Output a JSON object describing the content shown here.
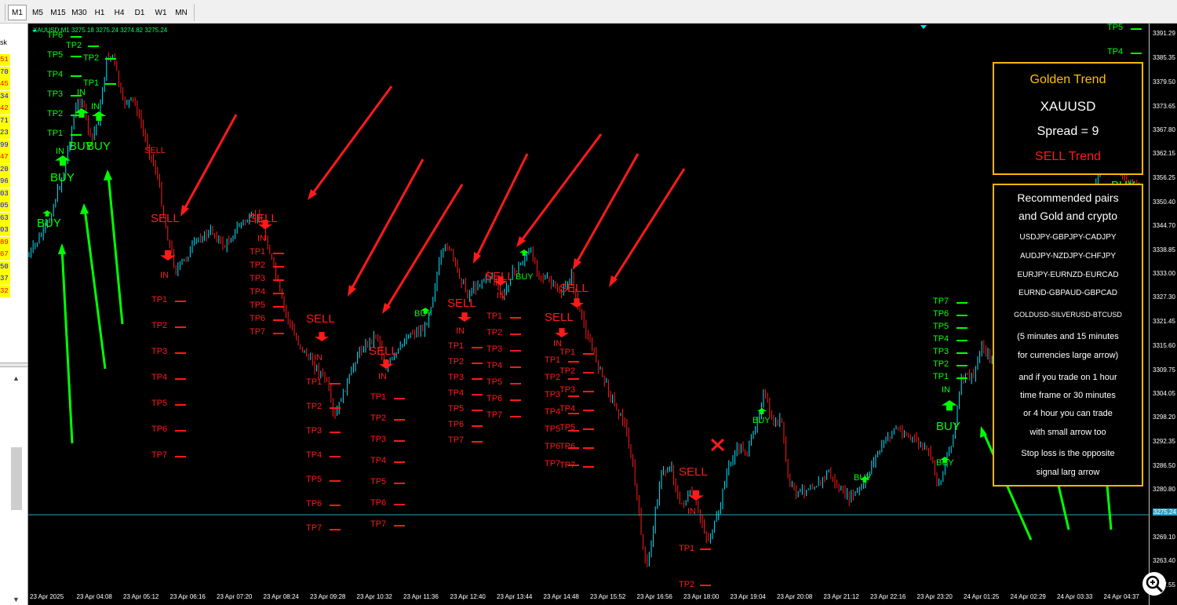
{
  "toolbar": {
    "timeframes": [
      "M1",
      "M5",
      "M15",
      "M30",
      "H1",
      "H4",
      "D1",
      "W1",
      "MN"
    ],
    "active": "M1"
  },
  "left_panel": {
    "label": "sk",
    "values": [
      "51",
      "70",
      "45",
      "34",
      "42",
      "71",
      "23",
      "99",
      "47",
      "20",
      "96",
      "03",
      "05",
      "63",
      "03",
      "89",
      "67",
      "50",
      "37",
      "32"
    ],
    "value_colors": [
      "#ff0000",
      "#0000ff",
      "#ff0000",
      "#0000ff",
      "#ff0000",
      "#0000ff",
      "#0000ff",
      "#0000ff",
      "#ff0000",
      "#0000ff",
      "#0000ff",
      "#0000ff",
      "#0000ff",
      "#0000ff",
      "#0000ff",
      "#ff0000",
      "#ff0000",
      "#0000ff",
      "#0000ff",
      "#ff0000"
    ]
  },
  "chart_header": "XAUUSD,M1 3275.18 3275.24 3274.82 3275.24",
  "price_axis": {
    "ticks": [
      "3391.29",
      "3385.35",
      "3379.50",
      "3373.65",
      "3367.80",
      "3362.15",
      "3356.25",
      "3350.40",
      "3344.70",
      "3338.85",
      "3333.00",
      "3327.30",
      "3321.45",
      "3315.60",
      "3309.75",
      "3304.05",
      "3298.20",
      "3292.35",
      "3286.50",
      "3280.80",
      "3275.24",
      "3269.10",
      "3263.40",
      "3257.55"
    ],
    "current_price": "3275.24",
    "scale": {
      "low": 3257.55,
      "high": 3391.29
    }
  },
  "time_axis": {
    "ticks": [
      "23 Apr 2025",
      "23 Apr 04:08",
      "23 Apr 05:12",
      "23 Apr 06:16",
      "23 Apr 07:20",
      "23 Apr 08:24",
      "23 Apr 09:28",
      "23 Apr 10:32",
      "23 Apr 11:36",
      "23 Apr 12:40",
      "23 Apr 13:44",
      "23 Apr 14:48",
      "23 Apr 15:52",
      "23 Apr 16:56",
      "23 Apr 18:00",
      "23 Apr 19:04",
      "23 Apr 20:08",
      "23 Apr 21:12",
      "23 Apr 22:16",
      "23 Apr 23:20",
      "24 Apr 01:25",
      "24 Apr 02:29",
      "24 Apr 03:33",
      "24 Apr 04:37"
    ]
  },
  "trend_box": {
    "title": "Golden Trend",
    "symbol": "XAUUSD",
    "spread": "Spread = 9",
    "trend": "SELL Trend"
  },
  "info_box": {
    "heading1": "Recommended pairs",
    "heading2": "and Gold and crypto",
    "pairs1": "USDJPY-GBPJPY-CADJPY",
    "pairs2": "AUDJPY-NZDJPY-CHFJPY",
    "pairs3": "EURJPY-EURNZD-EURCAD",
    "pairs4": "EURND-GBPAUD-GBPCAD",
    "pairs5": "GOLDUSD-SILVERUSD-BTCUSD",
    "note1": "(5 minutes and 15 minutes",
    "note2": "for currencies large arrow)",
    "note3": "and if you trade on 1 hour",
    "note4": "time frame or 30 minutes",
    "note5": "or 4 hour you can trade",
    "note6": "with small arrow too",
    "note7": "Stop loss is the opposite",
    "note8": "signal larg arrow"
  },
  "labels": {
    "buy": "BUY",
    "sell": "SELL",
    "in": "IN",
    "tp1": "TP1",
    "tp2": "TP2",
    "tp3": "TP3",
    "tp4": "TP4",
    "tp5": "TP5",
    "tp6": "TP6",
    "tp7": "TP7"
  },
  "colors": {
    "bull": "#00e5ff",
    "bear": "#ff1a1a",
    "buy": "#00ff00",
    "sell": "#ff1a1a",
    "box_border": "#ffb800",
    "title_gold": "#ffc000"
  }
}
